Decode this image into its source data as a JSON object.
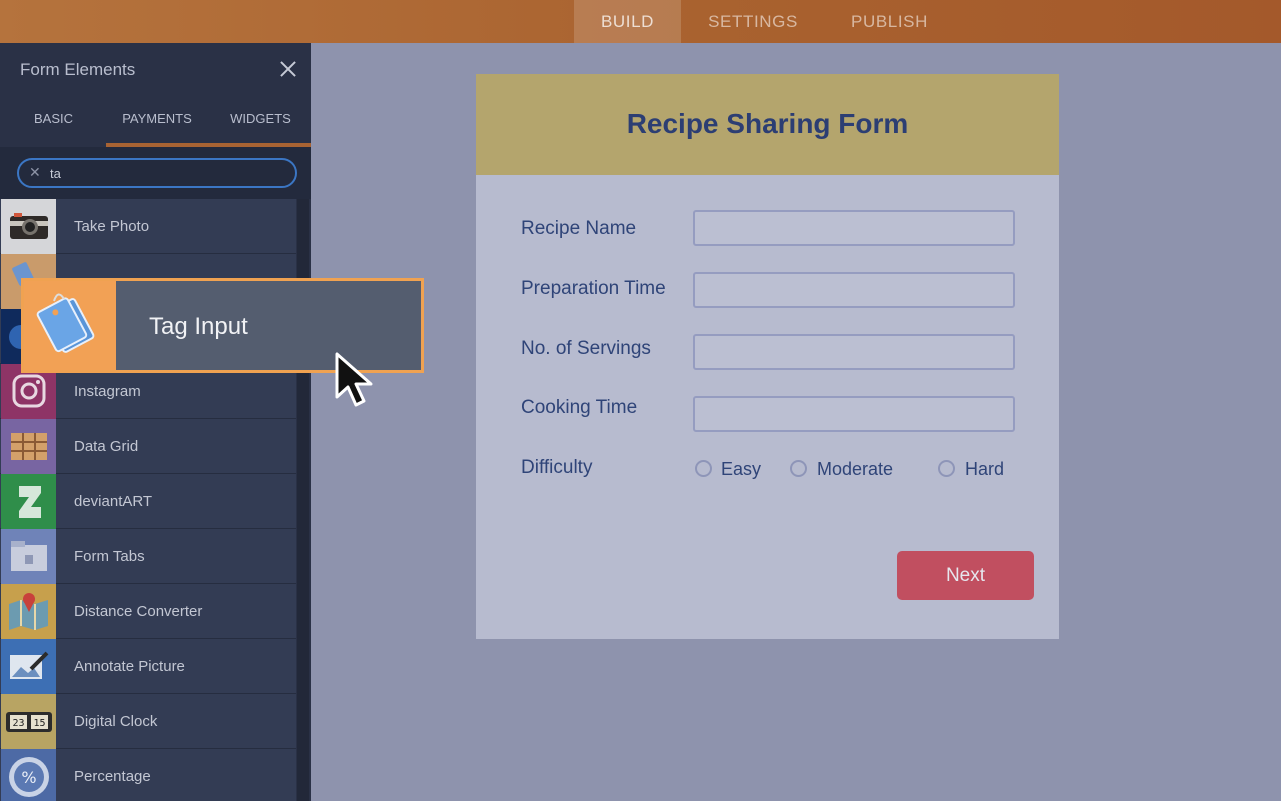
{
  "topbar": {
    "tabs": [
      {
        "label": "BUILD",
        "active": true
      },
      {
        "label": "SETTINGS",
        "active": false
      },
      {
        "label": "PUBLISH",
        "active": false
      }
    ]
  },
  "sidebar": {
    "title": "Form Elements",
    "tabs": [
      {
        "label": "BASIC"
      },
      {
        "label": "PAYMENTS"
      },
      {
        "label": "WIDGETS"
      }
    ],
    "search": {
      "value": "ta"
    },
    "items": [
      {
        "label": "Take Photo",
        "icon": "camera-icon"
      },
      {
        "label": "",
        "icon": "tag-icon"
      },
      {
        "label": "",
        "icon": "circle-icon"
      },
      {
        "label": "Instagram",
        "icon": "instagram-icon"
      },
      {
        "label": "Data Grid",
        "icon": "grid-icon"
      },
      {
        "label": "deviantART",
        "icon": "deviantart-icon"
      },
      {
        "label": "Form Tabs",
        "icon": "folder-tabs-icon"
      },
      {
        "label": "Distance Converter",
        "icon": "map-pin-icon"
      },
      {
        "label": "Annotate Picture",
        "icon": "annotate-icon"
      },
      {
        "label": "Digital Clock",
        "icon": "digital-clock-icon"
      },
      {
        "label": "Percentage",
        "icon": "percentage-icon"
      }
    ]
  },
  "drag_card": {
    "label": "Tag Input",
    "icon": "tag-icon"
  },
  "form": {
    "title": "Recipe Sharing Form",
    "fields": [
      {
        "label": "Recipe Name",
        "value": ""
      },
      {
        "label": "Preparation Time",
        "value": ""
      },
      {
        "label": "No. of Servings",
        "value": ""
      },
      {
        "label": "Cooking Time",
        "value": ""
      }
    ],
    "difficulty": {
      "label": "Difficulty",
      "options": [
        "Easy",
        "Moderate",
        "Hard"
      ]
    },
    "next_label": "Next"
  },
  "colors": {
    "topbar": "#a9622f",
    "sidebar": "#2a3146",
    "form_header": "#b4a56d",
    "title_text": "#2c3e73",
    "next_button": "#c14f60",
    "drag_border": "#f0a251"
  }
}
